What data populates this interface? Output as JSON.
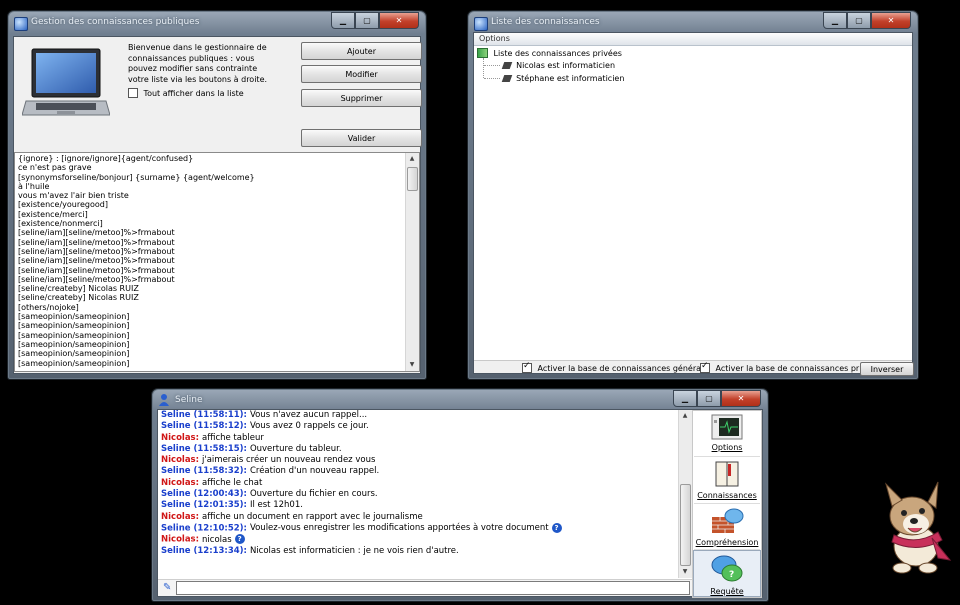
{
  "win1": {
    "title": "Gestion des connaissances publiques",
    "welcome": "Bienvenue dans le gestionnaire de connaissances publiques : vous pouvez modifier sans contrainte votre liste via les boutons à droite.",
    "show_all_label": "Tout afficher dans la liste",
    "buttons": {
      "add": "Ajouter",
      "edit": "Modifier",
      "delete": "Supprimer",
      "validate": "Valider"
    },
    "lines": [
      "{ignore} : [ignore/ignore]{agent/confused}",
      "ce n'est pas grave",
      "[synonymsforseline/bonjour] {surname} {agent/welcome}",
      "à l'huile",
      "vous m'avez l'air bien triste",
      "[existence/youregood]",
      "[existence/merci]",
      "[existence/nonmerci]",
      "[seline/iam][seline/metoo]%>frmabout",
      "[seline/iam][seline/metoo]%>frmabout",
      "[seline/iam][seline/metoo]%>frmabout",
      "[seline/iam][seline/metoo]%>frmabout",
      "[seline/iam][seline/metoo]%>frmabout",
      "[seline/iam][seline/metoo]%>frmabout",
      "[seline/createby] Nicolas RUIZ",
      "[seline/createby] Nicolas RUIZ",
      "[others/nojoke]",
      "[sameopinion/sameopinion]",
      "[sameopinion/sameopinion]",
      "[sameopinion/sameopinion]",
      "[sameopinion/sameopinion]",
      "[sameopinion/sameopinion]",
      "[sameopinion/sameopinion]"
    ]
  },
  "win2": {
    "title": "Liste des connaissances",
    "menu_options": "Options",
    "tree_root": "Liste des connaissances privées",
    "tree_items": [
      "Nicolas est informaticien",
      "Stéphane est informaticien"
    ],
    "chk_general": "Activer la base de connaissances générale.",
    "chk_private": "Activer la base de connaissances privée.",
    "invert": "Inverser"
  },
  "win3": {
    "title": "Seline",
    "chat": [
      {
        "who": "Seline (11:58:11):",
        "kind": "s",
        "text": "Vous n'avez aucun rappel..."
      },
      {
        "who": "Seline (11:58:12):",
        "kind": "s",
        "text": "Vous avez 0 rappels ce jour."
      },
      {
        "who": "Nicolas:",
        "kind": "n",
        "text": "affiche tableur"
      },
      {
        "who": "Seline (11:58:15):",
        "kind": "s",
        "text": "Ouverture du tableur."
      },
      {
        "who": "Nicolas:",
        "kind": "n",
        "text": "j'aimerais créer un nouveau rendez vous"
      },
      {
        "who": "Seline (11:58:32):",
        "kind": "s",
        "text": "Création d'un nouveau rappel."
      },
      {
        "who": "Nicolas:",
        "kind": "n",
        "text": "affiche le chat"
      },
      {
        "who": "Seline (12:00:43):",
        "kind": "s",
        "text": "Ouverture du fichier en cours."
      },
      {
        "who": "Seline (12:01:35):",
        "kind": "s",
        "text": "Il est 12h01."
      },
      {
        "who": "Nicolas:",
        "kind": "n",
        "text": "affiche un document en rapport avec le journalisme"
      },
      {
        "who": "Seline (12:10:52):",
        "kind": "s",
        "text": "Voulez-vous enregistrer les modifications apportées à votre document",
        "q": true
      },
      {
        "who": "Nicolas:",
        "kind": "n",
        "text": "nicolas",
        "q": true
      },
      {
        "who": "Seline (12:13:34):",
        "kind": "s",
        "text": "Nicolas est informaticien : je ne vois rien d'autre."
      }
    ],
    "side": [
      "Options",
      "Connaissances",
      "Compréhension",
      "Requête"
    ]
  },
  "colors": {
    "seline": "#1a3fcc",
    "nicolas": "#d01616",
    "desktop": "#000000"
  }
}
